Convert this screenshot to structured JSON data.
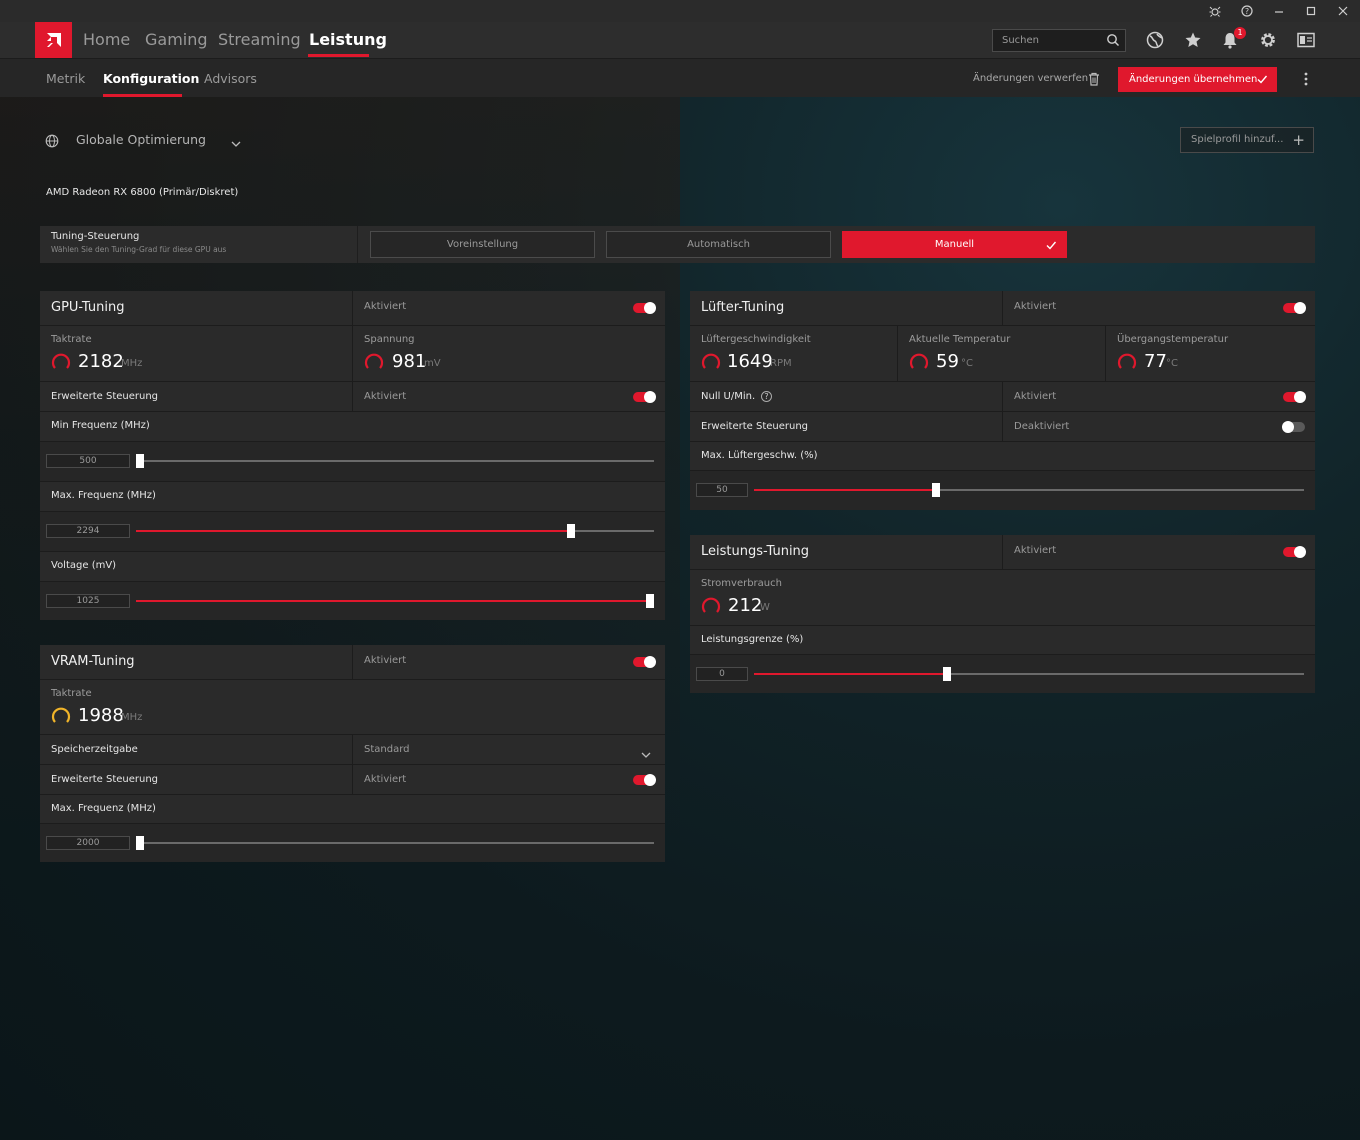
{
  "header": {
    "nav": [
      "Home",
      "Gaming",
      "Streaming",
      "Leistung"
    ],
    "active_nav": "Leistung",
    "search_placeholder": "Suchen",
    "notification_count": "1"
  },
  "subnav": {
    "tabs": [
      "Metrik",
      "Konfiguration",
      "Advisors"
    ],
    "active_tab": "Konfiguration",
    "discard_label": "Änderungen verwerfen",
    "apply_label": "Änderungen übernehmen"
  },
  "profile": {
    "selected": "Globale Optimierung",
    "add_label": "Spielprofil hinzuf..."
  },
  "gpu_name": "AMD Radeon RX 6800 (Primär/Diskret)",
  "tuning_control": {
    "title": "Tuning-Steuerung",
    "subtitle": "Wählen Sie den Tuning-Grad für diese GPU aus",
    "modes": [
      "Voreinstellung",
      "Automatisch",
      "Manuell"
    ],
    "active_mode": "Manuell"
  },
  "gpu_tuning": {
    "title": "GPU-Tuning",
    "status": "Aktiviert",
    "enabled": true,
    "metrics": [
      {
        "label": "Taktrate",
        "value": "2182",
        "unit": "MHz"
      },
      {
        "label": "Spannung",
        "value": "981",
        "unit": "mV"
      }
    ],
    "advanced": {
      "label": "Erweiterte Steuerung",
      "status": "Aktiviert",
      "enabled": true
    },
    "sliders": [
      {
        "label": "Min Frequenz (MHz)",
        "value": "500",
        "fraction": 0.0
      },
      {
        "label": "Max. Frequenz (MHz)",
        "value": "2294",
        "fraction": 0.84
      },
      {
        "label": "Voltage (mV)",
        "value": "1025",
        "fraction": 1.0
      }
    ]
  },
  "vram_tuning": {
    "title": "VRAM-Tuning",
    "status": "Aktiviert",
    "enabled": true,
    "metric": {
      "label": "Taktrate",
      "value": "1988",
      "unit": "MHz"
    },
    "memory_timing": {
      "label": "Speicherzeitgabe",
      "value": "Standard"
    },
    "advanced": {
      "label": "Erweiterte Steuerung",
      "status": "Aktiviert",
      "enabled": true
    },
    "slider": {
      "label": "Max. Frequenz (MHz)",
      "value": "2000",
      "fraction": 0.0
    }
  },
  "fan_tuning": {
    "title": "Lüfter-Tuning",
    "status": "Aktiviert",
    "enabled": true,
    "metrics": [
      {
        "label": "Lüftergeschwindigkeit",
        "value": "1649",
        "unit": "RPM"
      },
      {
        "label": "Aktuelle Temperatur",
        "value": "59",
        "unit": "°C"
      },
      {
        "label": "Übergangstemperatur",
        "value": "77",
        "unit": "°C"
      }
    ],
    "zero_rpm": {
      "label": "Null U/Min.",
      "status": "Aktiviert",
      "enabled": true
    },
    "advanced": {
      "label": "Erweiterte Steuerung",
      "status": "Deaktiviert",
      "enabled": false
    },
    "slider": {
      "label": "Max. Lüftergeschw. (%)",
      "value": "50",
      "fraction": 0.33
    }
  },
  "power_tuning": {
    "title": "Leistungs-Tuning",
    "status": "Aktiviert",
    "enabled": true,
    "metric": {
      "label": "Stromverbrauch",
      "value": "212",
      "unit": "W"
    },
    "slider": {
      "label": "Leistungsgrenze (%)",
      "value": "0",
      "fraction": 0.35
    }
  },
  "colors": {
    "accent": "#e0182d",
    "vram_gauge": "#f0b429",
    "panel": "#2a2a2a"
  }
}
